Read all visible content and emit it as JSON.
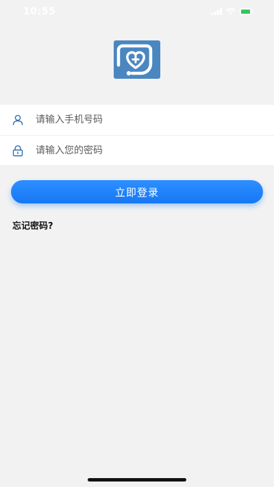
{
  "status_bar": {
    "time": "10:55"
  },
  "logo": {
    "icon": "heart-stethoscope-logo-icon",
    "color": "#4a87c0"
  },
  "form": {
    "phone": {
      "icon": "user-icon",
      "placeholder": "请输入手机号码",
      "value": ""
    },
    "password": {
      "icon": "lock-icon",
      "placeholder": "请输入您的密码",
      "value": ""
    }
  },
  "login_button": {
    "label": "立即登录",
    "color": "#1677f5"
  },
  "forgot_password": {
    "label": "忘记密码?"
  },
  "colors": {
    "background": "#f2f2f2",
    "accent": "#1677f5",
    "icon_blue": "#2b6cb0"
  }
}
